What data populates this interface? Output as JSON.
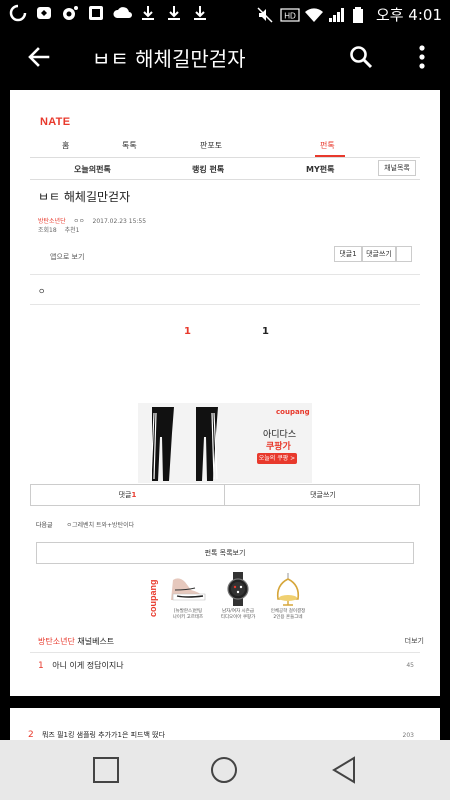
{
  "status_bar": {
    "time": "오후 4:01",
    "left_icons": [
      "notification-icon",
      "flag-icon",
      "camera-icon",
      "app-icon",
      "cloud-icon",
      "download-icon",
      "download-icon",
      "download-icon"
    ],
    "right_icons": [
      "mute-icon",
      "hd-icon",
      "wifi-icon",
      "signal-icon",
      "battery-icon"
    ],
    "hd_label": "HD"
  },
  "app_bar": {
    "title": "ㅂㅌ 해체길만걷자",
    "back_icon": "arrow-left-icon",
    "search_icon": "search-icon",
    "more_icon": "more-vertical-icon"
  },
  "page": {
    "logo": "NATE",
    "tabs": [
      {
        "label": "홈",
        "active": false
      },
      {
        "label": "톡톡",
        "active": false
      },
      {
        "label": "판포토",
        "active": false
      },
      {
        "label": "펀톡",
        "active": true
      }
    ],
    "subtabs": [
      "오늘의펀톡",
      "랭킹 펀톡",
      "MY펀톡"
    ],
    "channel_button": "채널목록",
    "post": {
      "title": "ㅂㅌ 해체길만걷자",
      "author": "방탄소년단",
      "author_extra": "ㅇㅇ",
      "date": "2017.02.23 15:55",
      "views": "조회18",
      "recommends": "추천1",
      "body": "ㅇ"
    },
    "app_view": "앱으로 보기",
    "buttons": {
      "comment": "댓글1",
      "write_comment": "댓글쓰기"
    },
    "votes": {
      "up": "1",
      "down": "1"
    },
    "ad": {
      "brand_logo": "coupang",
      "brand": "아디다스",
      "price_label": "쿠팡가",
      "today_label": "오늘의 쿠팡 >"
    },
    "comment_bar": {
      "comment_label": "댓글",
      "comment_count": "1",
      "write_label": "댓글쓰기"
    },
    "next_post": {
      "label": "다음글",
      "title": "ㅇ그레벤치 트와+방탄이다"
    },
    "list_button": "펀톡 목록보기",
    "coupang_vertical": "coupang",
    "products": [
      {
        "cap1": "[뉴발란스]반팅",
        "cap2": "나이키 고르테즈",
        "icon": "sneaker-icon"
      },
      {
        "cap1": "남자/여자 시즌급",
        "cap2": "티디오이아 쿠팡가",
        "icon": "watch-icon"
      },
      {
        "cap1": "인체공학 걸이결정",
        "cap2": "2인용 흔들그네",
        "icon": "swing-chair-icon"
      }
    ],
    "best": {
      "channel": "방탄소년단",
      "label": "채널베스트",
      "more": "더보기",
      "items": [
        {
          "rank": "1",
          "title": "아니 이게 정답이지나",
          "count": "45"
        }
      ]
    }
  },
  "page2": {
    "items": [
      {
        "rank": "2",
        "title": "뭐즈 필1킹 샘플링 추가가1은 피드백 떴다",
        "count": "203"
      }
    ]
  },
  "nav_bar": {
    "recent_icon": "square-icon",
    "home_icon": "circle-icon",
    "back_icon": "triangle-back-icon"
  }
}
